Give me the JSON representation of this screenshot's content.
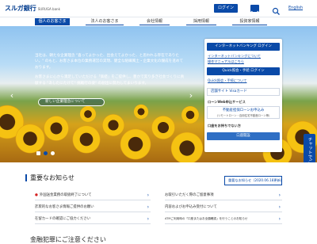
{
  "header": {
    "logo_text": "スルガ銀行",
    "logo_sub": "SURUGA bank",
    "login_label": "ログイン",
    "lang_label": "English"
  },
  "nav": {
    "items": [
      {
        "label": "個人のお客さま"
      },
      {
        "label": "法人のお客さま"
      },
      {
        "label": "会社情報"
      },
      {
        "label": "採用情報"
      },
      {
        "label": "投資家情報"
      }
    ]
  },
  "hero": {
    "paragraph1": "当社は、朝たな企業理念 \"喜ってよかった、出会えてよかった、と思われる存在でありたい。\" のもと、お客さま本位の業務運営の実現、健全な組織風土・企業文化の醸成を進めております。",
    "paragraph2": "お客さまに心から満足していただける「価値」をご提供し、豊かで実り多き社会づくりに貢献する \"あしたにたけて\" 挑戦行の姿\" の創出に努力してまいります。",
    "about_button": "新しい企業理念について",
    "prev_arrow": "‹",
    "next_arrow": "›"
  },
  "panel": {
    "internet_banking_login": "インターネットバンキング ログイン",
    "ib_link": "インターネットバンキングについて",
    "manual_link": "操作マニュアルはこちら",
    "quick_login": "Quick照会・手続 ログイン",
    "quick_link": "Quick照会・手続について",
    "shop_button": "店舗サイト Visaカード",
    "loan_heading": "ローンWeb申込サービス",
    "loan_button": "不動産担保ローンお申込み",
    "loan_sub": "(リモートローン・自用住宅不動産ローン等)",
    "account_heading": "口座をお持ちでない方",
    "account_button": "口座開設"
  },
  "chat": {
    "label": "チャットでご質問"
  },
  "news": {
    "title": "重要なお知らせ",
    "important_button": "重要なお知らせ（2020.06.18更新）",
    "left_items": [
      {
        "text": "外国送金業務の取扱終了について",
        "warn": true
      },
      {
        "text": "詐欺的なお客さま情報ご提供のお願い",
        "warn": false
      },
      {
        "text": "在留カードの確認にご協力ください",
        "warn": false
      }
    ],
    "right_items": [
      {
        "text": "お取引いただく際のご留意事項"
      },
      {
        "text": "内容およびお申込み受付について"
      },
      {
        "text": "ATMご利用時の「口座またはお全額確認」を行うことのお知らせ"
      }
    ],
    "next_section": "金融犯罪にご注意ください"
  },
  "colors": {
    "brand_blue": "#0a4aa8",
    "warning_red": "#d42020"
  }
}
